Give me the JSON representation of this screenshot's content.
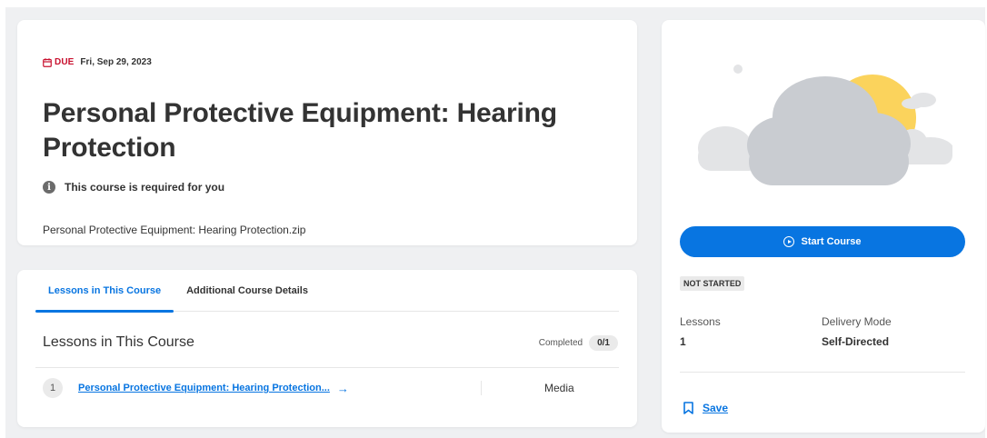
{
  "header": {
    "due_label": "DUE",
    "due_date": "Fri, Sep 29, 2023",
    "title": "Personal Protective Equipment: Hearing Protection",
    "required_text": "This course is required for you",
    "attachment": "Personal Protective Equipment: Hearing Protection.zip"
  },
  "tabs": [
    {
      "label": "Lessons in This Course",
      "active": true
    },
    {
      "label": "Additional Course Details",
      "active": false
    }
  ],
  "lessons": {
    "heading": "Lessons in This Course",
    "completed_label": "Completed",
    "completed_count": "0/1",
    "items": [
      {
        "number": "1",
        "title": "Personal Protective Equipment: Hearing Protection...",
        "type": "Media"
      }
    ]
  },
  "side": {
    "start_label": "Start Course",
    "status": "NOT STARTED",
    "lessons_label": "Lessons",
    "lessons_value": "1",
    "delivery_label": "Delivery Mode",
    "delivery_value": "Self-Directed",
    "save_label": "Save"
  },
  "icons": {
    "calendar": "calendar-icon",
    "info": "info-icon",
    "arrow": "arrow-right-icon",
    "play": "play-circle-icon",
    "bookmark": "bookmark-icon"
  },
  "colors": {
    "accent": "#0875e1",
    "due": "#c8102e",
    "background": "#eff0f2",
    "sun": "#fbd35c",
    "cloud": "#c9ccd1"
  }
}
